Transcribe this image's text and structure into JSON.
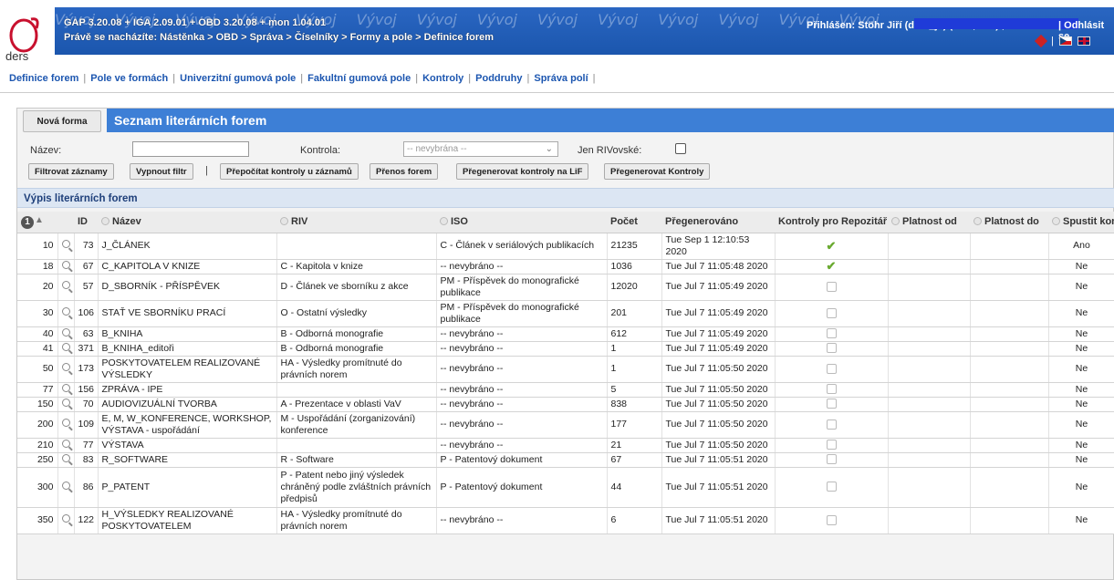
{
  "header": {
    "logo_text": "ders",
    "watermark": "Vývoj",
    "version": "GAP 3.20.08 + IGA 2.09.01 + OBD 3.20.08 + mon 1.04.01",
    "breadcrumb": "Právě se nacházíte: Nástěnka > OBD > Správa > Číselníky > Formy a pole > Definice forem",
    "login": "Přihlášen: Stöhr Jiří (ders_js) (FHS,PRF) ,",
    "logout": "| Odhlásit se",
    "lang_sep": "|"
  },
  "nav": {
    "links": [
      "Definice forem",
      "Pole ve formách",
      "Univerzitní gumová pole",
      "Fakultní gumová pole",
      "Kontroly",
      "Poddruhy",
      "Správa polí"
    ],
    "separator": "|"
  },
  "panel": {
    "new_button": "Nová forma",
    "title": "Seznam literárních forem"
  },
  "filter": {
    "name_label": "Název:",
    "name_value": "",
    "control_label": "Kontrola:",
    "control_selected": "-- nevybrána --",
    "riv_label": "Jen RIVovské:",
    "buttons": {
      "filter": "Filtrovat záznamy",
      "clear": "Vypnout filtr",
      "recount": "Přepočítat kontroly u záznamů",
      "transfer": "Přenos forem",
      "regen_lif": "Přegenerovat kontroly na LiF",
      "regen": "Přegenerovat Kontroly"
    },
    "separator": "|"
  },
  "list": {
    "subtitle": "Výpis literárních forem",
    "sort_badge": "1",
    "columns": {
      "id": "ID",
      "name": "Název",
      "riv": "RIV",
      "iso": "ISO",
      "count": "Počet",
      "regen": "Přegenerováno",
      "repo": "Kontroly pro Repozitář",
      "valid_from": "Platnost od",
      "valid_to": "Platnost do",
      "run": "Spustit kontroly"
    },
    "rows": [
      {
        "order": "10",
        "id": "73",
        "name": "J_ČLÁNEK",
        "riv": "",
        "iso": "C - Článek v seriálových publikacích",
        "count": "21235",
        "regen": "Tue Sep 1 12:10:53 2020",
        "repo": true,
        "run": "Ano"
      },
      {
        "order": "18",
        "id": "67",
        "name": "C_KAPITOLA V KNIZE",
        "riv": "C - Kapitola v knize",
        "iso": "-- nevybráno --",
        "count": "1036",
        "regen": "Tue Jul 7 11:05:48 2020",
        "repo": true,
        "run": "Ne"
      },
      {
        "order": "20",
        "id": "57",
        "name": "D_SBORNÍK - PŘÍSPĚVEK",
        "riv": "D - Článek ve sborníku z akce",
        "iso": "PM - Příspěvek do monografické publikace",
        "count": "12020",
        "regen": "Tue Jul 7 11:05:49 2020",
        "repo": false,
        "run": "Ne"
      },
      {
        "order": "30",
        "id": "106",
        "name": "STAŤ VE SBORNÍKU PRACÍ",
        "riv": "O - Ostatní výsledky",
        "iso": "PM - Příspěvek do monografické publikace",
        "count": "201",
        "regen": "Tue Jul 7 11:05:49 2020",
        "repo": false,
        "run": "Ne"
      },
      {
        "order": "40",
        "id": "63",
        "name": "B_KNIHA",
        "riv": "B - Odborná monografie",
        "iso": "-- nevybráno --",
        "count": "612",
        "regen": "Tue Jul 7 11:05:49 2020",
        "repo": false,
        "run": "Ne"
      },
      {
        "order": "41",
        "id": "371",
        "name": "B_KNIHA_editoři",
        "riv": "B - Odborná monografie",
        "iso": "-- nevybráno --",
        "count": "1",
        "regen": "Tue Jul 7 11:05:49 2020",
        "repo": false,
        "run": "Ne"
      },
      {
        "order": "50",
        "id": "173",
        "name": "POSKYTOVATELEM REALIZOVANÉ VÝSLEDKY",
        "riv": "HA - Výsledky promítnuté do právních norem",
        "iso": "-- nevybráno --",
        "count": "1",
        "regen": "Tue Jul 7 11:05:50 2020",
        "repo": false,
        "run": "Ne"
      },
      {
        "order": "77",
        "id": "156",
        "name": "ZPRÁVA - IPE",
        "riv": "",
        "iso": "-- nevybráno --",
        "count": "5",
        "regen": "Tue Jul 7 11:05:50 2020",
        "repo": false,
        "run": "Ne"
      },
      {
        "order": "150",
        "id": "70",
        "name": "AUDIOVIZUÁLNÍ TVORBA",
        "riv": "A - Prezentace v oblasti VaV",
        "iso": "-- nevybráno --",
        "count": "838",
        "regen": "Tue Jul 7 11:05:50 2020",
        "repo": false,
        "run": "Ne"
      },
      {
        "order": "200",
        "id": "109",
        "name": "E, M, W_KONFERENCE, WORKSHOP, VÝSTAVA - uspořádání",
        "riv": "M - Uspořádání (zorganizování) konference",
        "iso": "-- nevybráno --",
        "count": "177",
        "regen": "Tue Jul 7 11:05:50 2020",
        "repo": false,
        "run": "Ne"
      },
      {
        "order": "210",
        "id": "77",
        "name": "VÝSTAVA",
        "riv": "",
        "iso": "-- nevybráno --",
        "count": "21",
        "regen": "Tue Jul 7 11:05:50 2020",
        "repo": false,
        "run": "Ne"
      },
      {
        "order": "250",
        "id": "83",
        "name": "R_SOFTWARE",
        "riv": "R - Software",
        "iso": "P - Patentový dokument",
        "count": "67",
        "regen": "Tue Jul 7 11:05:51 2020",
        "repo": false,
        "run": "Ne"
      },
      {
        "order": "300",
        "id": "86",
        "name": "P_PATENT",
        "riv": "P - Patent nebo jiný výsledek chráněný podle zvláštních právních předpisů",
        "iso": "P - Patentový dokument",
        "count": "44",
        "regen": "Tue Jul 7 11:05:51 2020",
        "repo": false,
        "run": "Ne"
      },
      {
        "order": "350",
        "id": "122",
        "name": "H_VÝSLEDKY REALIZOVANÉ POSKYTOVATELEM",
        "riv": "HA - Výsledky promítnuté do právních norem",
        "iso": "-- nevybráno --",
        "count": "6",
        "regen": "Tue Jul 7 11:05:51 2020",
        "repo": false,
        "run": "Ne"
      }
    ]
  },
  "colors": {
    "header_blue": "#1b56ad",
    "panel_title_blue": "#3d7fd6",
    "link_blue": "#1c56b0",
    "check_green": "#6aaa30"
  }
}
